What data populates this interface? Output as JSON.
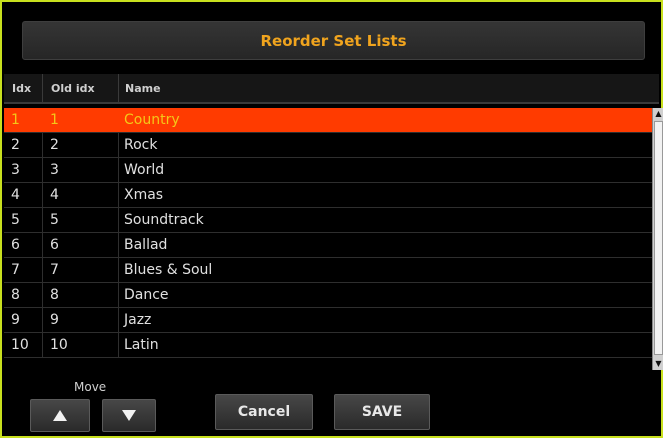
{
  "dialog": {
    "title": "Reorder Set Lists"
  },
  "columns": {
    "idx": "Idx",
    "old_idx": "Old idx",
    "name": "Name"
  },
  "rows": [
    {
      "idx": "1",
      "old_idx": "1",
      "name": "Country",
      "selected": true
    },
    {
      "idx": "2",
      "old_idx": "2",
      "name": "Rock"
    },
    {
      "idx": "3",
      "old_idx": "3",
      "name": "World"
    },
    {
      "idx": "4",
      "old_idx": "4",
      "name": "Xmas"
    },
    {
      "idx": "5",
      "old_idx": "5",
      "name": "Soundtrack"
    },
    {
      "idx": "6",
      "old_idx": "6",
      "name": "Ballad"
    },
    {
      "idx": "7",
      "old_idx": "7",
      "name": "Blues & Soul"
    },
    {
      "idx": "8",
      "old_idx": "8",
      "name": "Dance"
    },
    {
      "idx": "9",
      "old_idx": "9",
      "name": "Jazz"
    },
    {
      "idx": "10",
      "old_idx": "10",
      "name": "Latin"
    }
  ],
  "move": {
    "label": "Move",
    "up_icon": "triangle-up-icon",
    "down_icon": "triangle-down-icon"
  },
  "buttons": {
    "cancel": "Cancel",
    "save": "SAVE"
  },
  "colors": {
    "frame_border": "#c8e01e",
    "title_text": "#f0a41e",
    "selected_row_bg": "#ff3b00",
    "selected_row_text": "#f4c818"
  }
}
